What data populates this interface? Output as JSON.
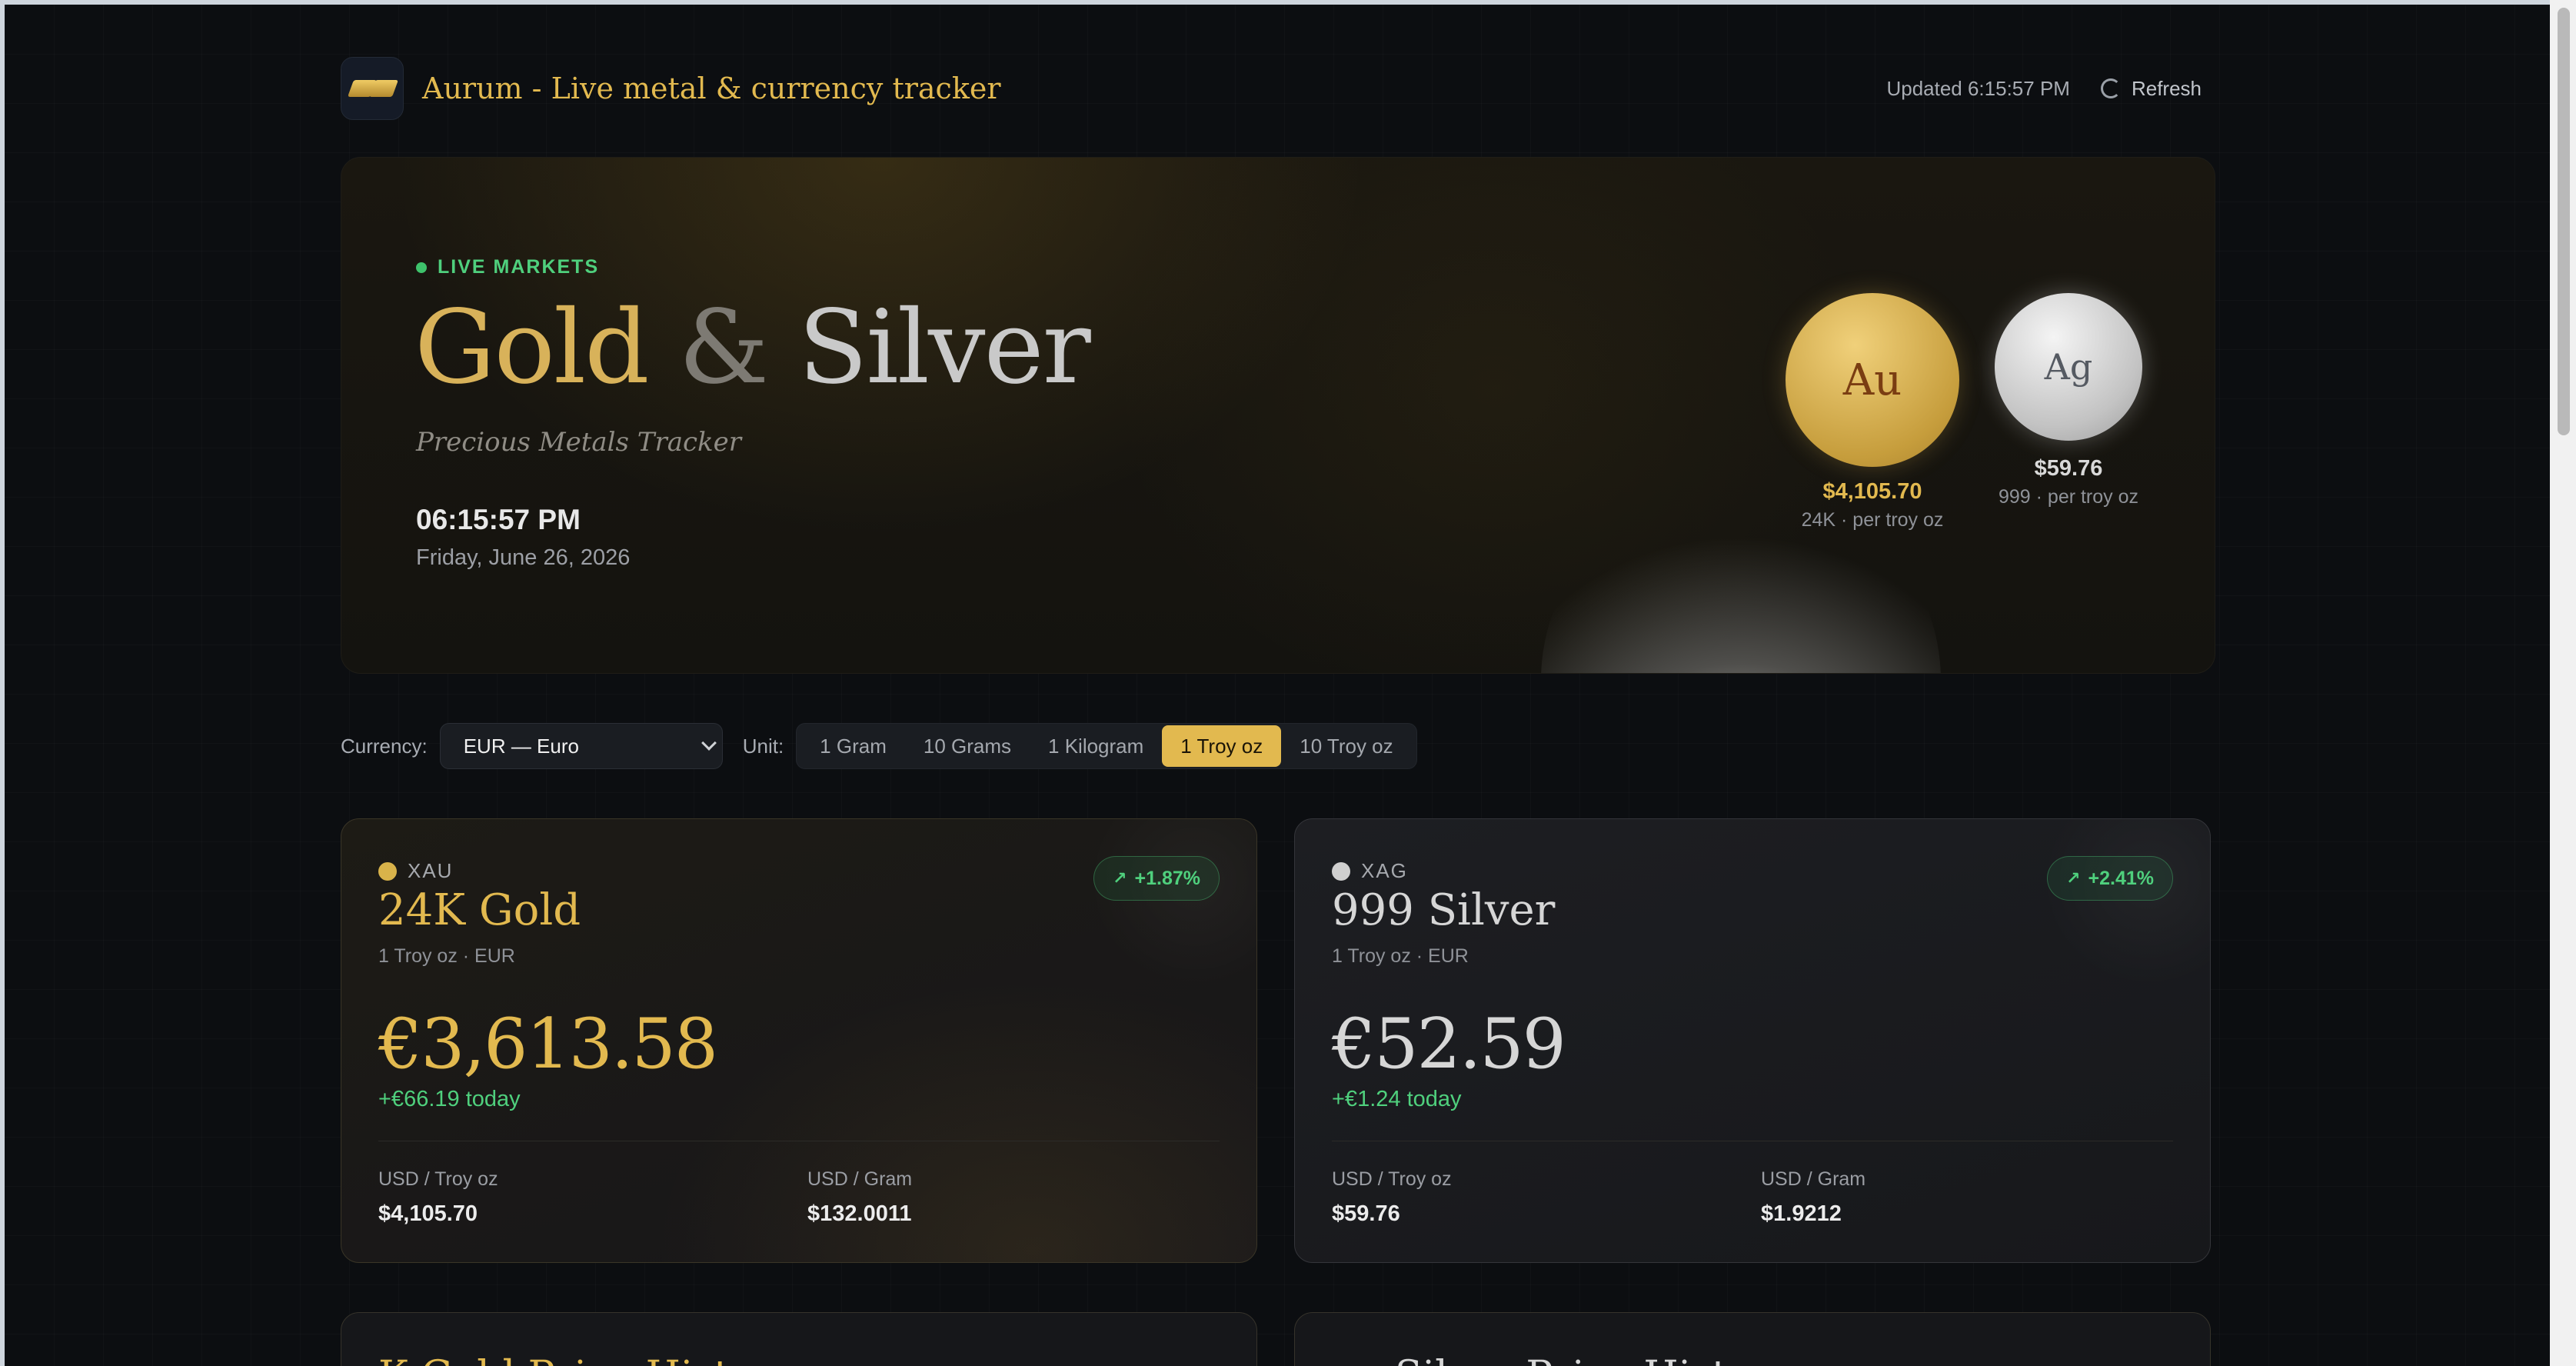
{
  "header": {
    "app_title": "Aurum - Live metal & currency tracker",
    "updated": "Updated 6:15:57 PM",
    "refresh_label": "Refresh"
  },
  "hero": {
    "live_label": "LIVE MARKETS",
    "title_gold": "Gold",
    "title_amp": "&",
    "title_silver": "Silver",
    "subtitle": "Precious Metals Tracker",
    "time": "06:15:57 PM",
    "date": "Friday, June 26, 2026",
    "gold_coin": {
      "symbol": "Au",
      "price": "$4,105.70",
      "sub": "24K · per troy oz"
    },
    "silver_coin": {
      "symbol": "Ag",
      "price": "$59.76",
      "sub": "999 · per troy oz"
    }
  },
  "controls": {
    "currency_label": "Currency:",
    "currency_value": "EUR — Euro",
    "unit_label": "Unit:",
    "units": [
      "1 Gram",
      "10 Grams",
      "1 Kilogram",
      "1 Troy oz",
      "10 Troy oz"
    ],
    "active_unit": "1 Troy oz"
  },
  "cards": [
    {
      "symbol": "XAU",
      "name": "24K Gold",
      "unit": "1 Troy oz · EUR",
      "badge": "+1.87%",
      "price": "€3,613.58",
      "change": "+€66.19 today",
      "stat1_label": "USD / Troy oz",
      "stat1_value": "$4,105.70",
      "stat2_label": "USD / Gram",
      "stat2_value": "$132.0011",
      "dot_color": "#d9b34a"
    },
    {
      "symbol": "XAG",
      "name": "999 Silver",
      "unit": "1 Troy oz · EUR",
      "badge": "+2.41%",
      "price": "€52.59",
      "change": "+€1.24 today",
      "stat1_label": "USD / Troy oz",
      "stat1_value": "$59.76",
      "stat2_label": "USD / Gram",
      "stat2_value": "$1.9212",
      "dot_color": "#cfcfcf"
    }
  ],
  "lower_cards": [
    "K Gold Price History",
    "Silver Price History"
  ],
  "colors": {
    "gold": "#e2b94f",
    "positive": "#4fd07d",
    "background": "#0c0e11"
  }
}
